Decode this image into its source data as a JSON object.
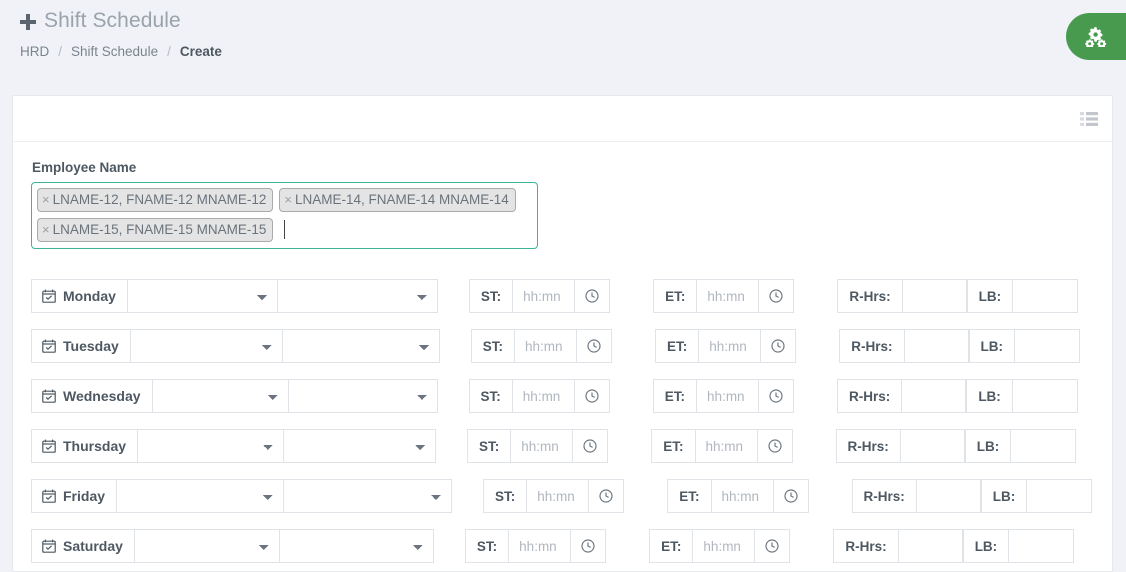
{
  "page": {
    "title": "Shift Schedule",
    "plus_icon": "plus-icon",
    "breadcrumb": [
      "HRD",
      "Shift Schedule",
      "Create"
    ],
    "breadcrumb_separator": "/"
  },
  "side_tab": {
    "icon": "cogs-icon",
    "color": "#489b4e"
  },
  "card": {
    "header_icon": "list-icon",
    "form": {
      "employee_label": "Employee Name",
      "employee_tags": [
        "LNAME-12, FNAME-12 MNAME-12",
        "LNAME-14, FNAME-14 MNAME-14",
        "LNAME-15, FNAME-15 MNAME-15"
      ],
      "tag_remove_glyph": "×",
      "focus_color": "#3cb49a"
    },
    "labels": {
      "start_time": "ST:",
      "end_time": "ET:",
      "regular_hours": "R-Hrs:",
      "lunch_break": "LB:",
      "time_placeholder": "hh:mn",
      "day_icon": "calendar-check-icon",
      "clock_icon": "clock-icon"
    },
    "days": [
      {
        "name": "Monday",
        "shift": "",
        "type": "",
        "st": "",
        "et": "",
        "rhrs": "",
        "lb": ""
      },
      {
        "name": "Tuesday",
        "shift": "",
        "type": "",
        "st": "",
        "et": "",
        "rhrs": "",
        "lb": ""
      },
      {
        "name": "Wednesday",
        "shift": "",
        "type": "",
        "st": "",
        "et": "",
        "rhrs": "",
        "lb": ""
      },
      {
        "name": "Thursday",
        "shift": "",
        "type": "",
        "st": "",
        "et": "",
        "rhrs": "",
        "lb": ""
      },
      {
        "name": "Friday",
        "shift": "",
        "type": "",
        "st": "",
        "et": "",
        "rhrs": "",
        "lb": ""
      },
      {
        "name": "Saturday",
        "shift": "",
        "type": "",
        "st": "",
        "et": "",
        "rhrs": "",
        "lb": ""
      }
    ]
  }
}
